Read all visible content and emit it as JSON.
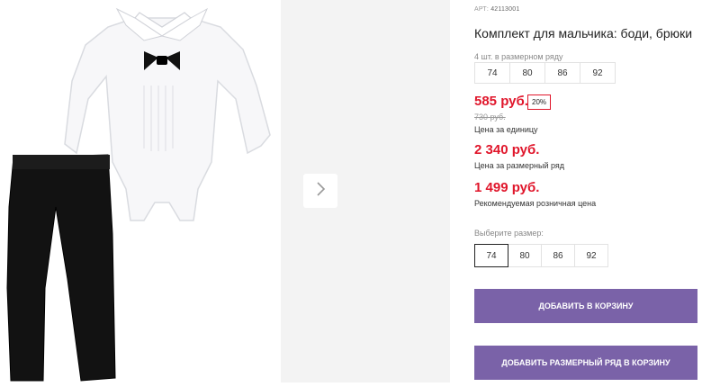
{
  "product": {
    "sku_label": "АРТ:",
    "sku": "42113001",
    "title": "Комплект для мальчика: боди, брюки"
  },
  "pack": {
    "label": "4 шт. в размерном ряду",
    "sizes": [
      "74",
      "80",
      "86",
      "92"
    ]
  },
  "pricing": {
    "unit_price": "585 руб.",
    "discount": "20%",
    "old_price": "730 руб.",
    "unit_caption": "Цена за единицу",
    "pack_price": "2 340 руб.",
    "pack_caption": "Цена за размерный ряд",
    "retail_price": "1 499 руб.",
    "retail_caption": "Рекомендуемая розничная цена",
    "accent_color": "#e0162b"
  },
  "size_select": {
    "label": "Выберите размер:",
    "sizes": [
      "74",
      "80",
      "86",
      "92"
    ],
    "selected": "74"
  },
  "buttons": {
    "add_to_cart": "ДОБАВИТЬ В КОРЗИНУ",
    "add_pack_to_cart": "ДОБАВИТЬ РАЗМЕРНЫЙ РЯД В КОРЗИНУ",
    "color": "#7a62a8"
  },
  "gallery": {
    "next_icon": "chevron-right-icon"
  }
}
